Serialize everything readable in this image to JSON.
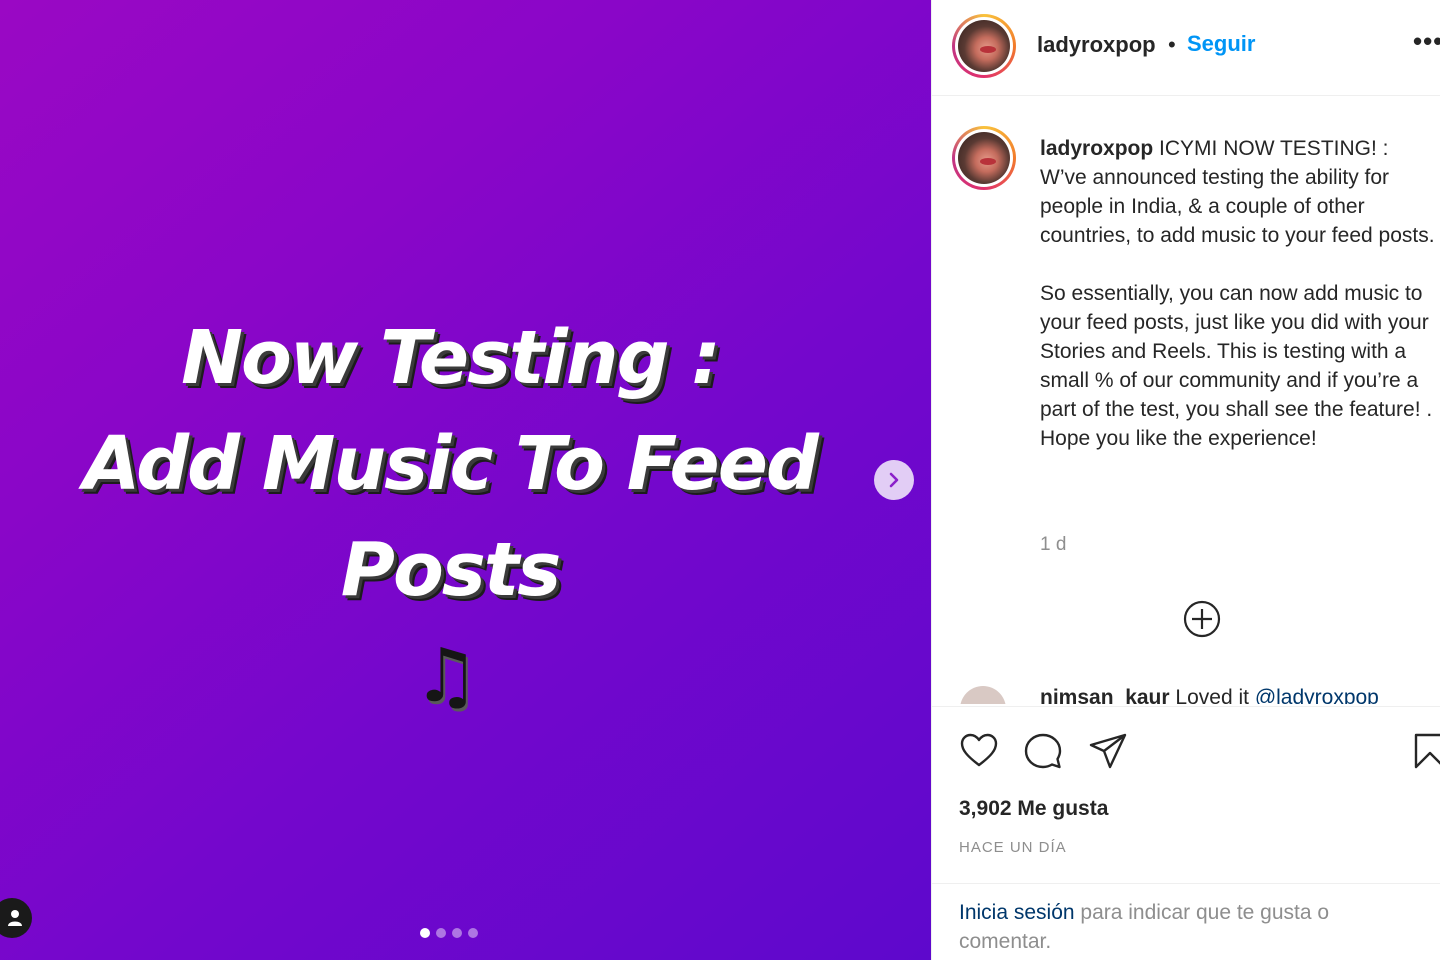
{
  "media": {
    "headline_lines": [
      "Now Testing :",
      "Add Music To Feed",
      "Posts"
    ],
    "music_note": "♫",
    "carousel": {
      "total": 4,
      "active_index": 0
    },
    "background_colors": [
      "#9a08c4",
      "#5e08cc"
    ]
  },
  "header": {
    "username": "ladyroxpop",
    "separator": "•",
    "follow_label": "Seguir",
    "more_label": "•••"
  },
  "caption": {
    "username": "ladyroxpop",
    "paragraph1": "ICYMI NOW TESTING! : W’ve announced testing the ability for people in India, & a couple of other countries, to add music to your feed posts.",
    "paragraph2": "So essentially, you can now add music to your feed posts, just like you did with your Stories and Reels. This is testing with a small % of our community and if you’re a part of the test, you shall see the feature! . Hope you like the experience!",
    "time": "1 d"
  },
  "comment_peek": {
    "username": "nimsan_kaur",
    "text": "Loved it",
    "mention": "@ladyroxpop"
  },
  "actions": {
    "likes_label": "3,902 Me gusta",
    "timestamp": "HACE UN DÍA"
  },
  "login": {
    "link_label": "Inicia sesión",
    "rest_text": " para indicar que te gusta o comentar."
  },
  "colors": {
    "accent_blue": "#0095f6",
    "link_dark": "#00376b",
    "text": "#262626",
    "muted": "#8e8e8e"
  }
}
